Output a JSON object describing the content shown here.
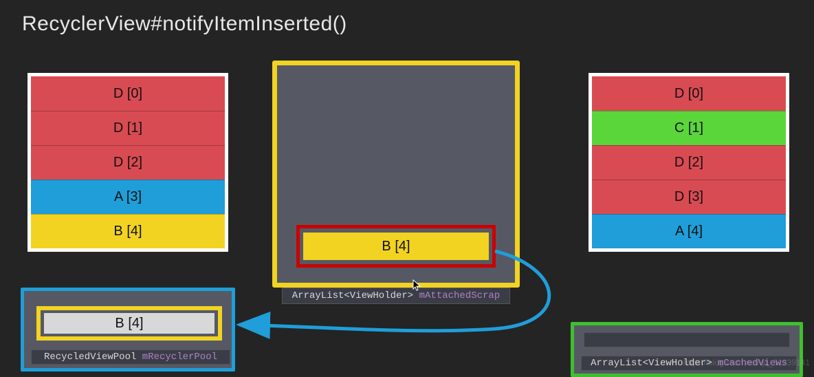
{
  "title": "RecyclerView#notifyItemInserted()",
  "colors": {
    "bg": "#242424",
    "panel": "#565964",
    "red": "#d94b53",
    "blue": "#1f9ed9",
    "yellow": "#f2d322",
    "green": "#5ad53a",
    "grey": "#d8d8d8"
  },
  "left_list": {
    "rows": [
      {
        "label": "D [0]",
        "color": "red"
      },
      {
        "label": "D [1]",
        "color": "red"
      },
      {
        "label": "D [2]",
        "color": "red"
      },
      {
        "label": "A [3]",
        "color": "blue"
      },
      {
        "label": "B [4]",
        "color": "yellow"
      }
    ]
  },
  "right_list": {
    "rows": [
      {
        "label": "D [0]",
        "color": "red"
      },
      {
        "label": "C [1]",
        "color": "green"
      },
      {
        "label": "D [2]",
        "color": "red"
      },
      {
        "label": "D [3]",
        "color": "red"
      },
      {
        "label": "A [4]",
        "color": "blue"
      }
    ]
  },
  "center": {
    "item_label": "B [4]",
    "caption_type": "ArrayList<ViewHolder>",
    "caption_var": "mAttachedScrap"
  },
  "bottom_left": {
    "item_label": "B [4]",
    "caption_type": "RecycledViewPool",
    "caption_var": "mRecyclerPool"
  },
  "bottom_right": {
    "caption_type": "ArrayList<ViewHolder>",
    "caption_var": "mCachedViews"
  },
  "watermark": "https://blog.csdn.net/qq_31339141"
}
